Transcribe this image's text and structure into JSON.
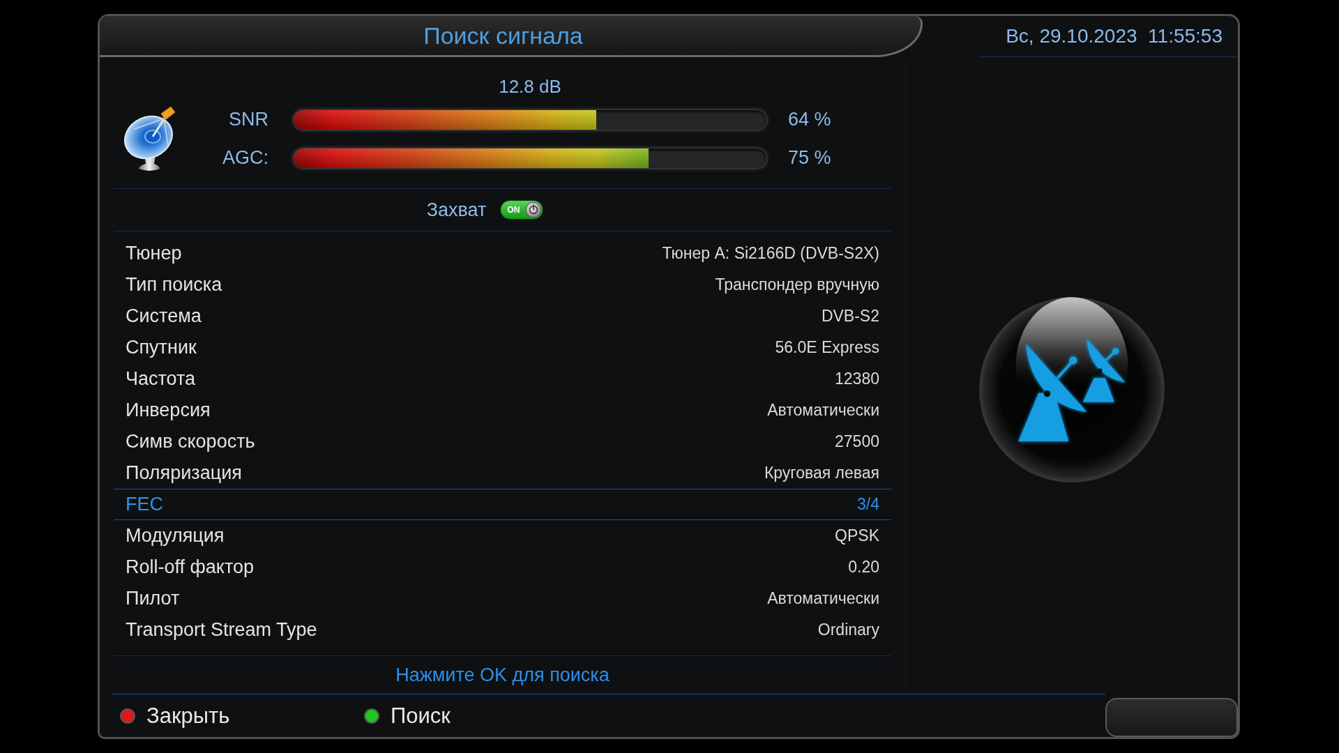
{
  "header": {
    "title": "Поиск сигнала",
    "datetime": "Вс, 29.10.2023  11:55:53"
  },
  "signal": {
    "quality": "12.8 dB",
    "meters": [
      {
        "label": "SNR",
        "level": 0.64,
        "reading": "64 %"
      },
      {
        "label": "AGC:",
        "level": 0.75,
        "reading": "75 %"
      }
    ]
  },
  "lock": {
    "label": "Захват",
    "on": true,
    "toggle_text": "ON"
  },
  "settings": [
    {
      "label": "Тюнер",
      "value": "Тюнер A: Si2166D (DVB-S2X)",
      "selected": false
    },
    {
      "label": "Тип поиска",
      "value": "Транспондер вручную",
      "selected": false
    },
    {
      "label": "Система",
      "value": "DVB-S2",
      "selected": false
    },
    {
      "label": "Спутник",
      "value": "56.0E Express",
      "selected": false
    },
    {
      "label": "Частота",
      "value": "12380",
      "selected": false
    },
    {
      "label": "Инверсия",
      "value": "Автоматически",
      "selected": false
    },
    {
      "label": "Симв скорость",
      "value": "27500",
      "selected": false
    },
    {
      "label": "Поляризация",
      "value": "Круговая левая",
      "selected": false
    },
    {
      "label": "FEC",
      "value": "3/4",
      "selected": true
    },
    {
      "label": "Модуляция",
      "value": "QPSK",
      "selected": false
    },
    {
      "label": "Roll-off фактор",
      "value": "0.20",
      "selected": false
    },
    {
      "label": "Пилот",
      "value": "Автоматически",
      "selected": false
    },
    {
      "label": "Transport Stream Type",
      "value": "Ordinary",
      "selected": false
    }
  ],
  "hint": "Нажмите OK для поиска",
  "buttons": [
    {
      "label": "Закрыть",
      "color": "#e01818"
    },
    {
      "label": "Поиск",
      "color": "#1ec81e"
    }
  ]
}
